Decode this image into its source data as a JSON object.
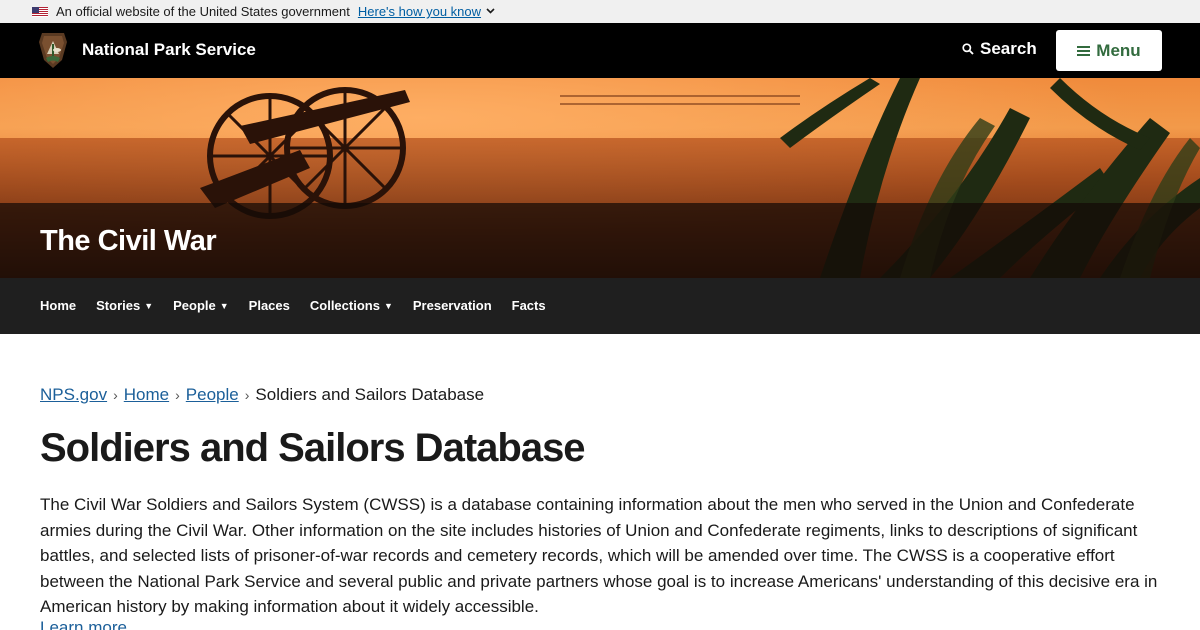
{
  "gov_banner": {
    "text": "An official website of the United States government",
    "link": "Here's how you know"
  },
  "header": {
    "site_title": "National Park Service",
    "search_label": "Search",
    "menu_label": "Menu"
  },
  "hero": {
    "title": "The Civil War"
  },
  "sub_nav": {
    "items": [
      {
        "label": "Home",
        "has_dropdown": false
      },
      {
        "label": "Stories",
        "has_dropdown": true
      },
      {
        "label": "People",
        "has_dropdown": true
      },
      {
        "label": "Places",
        "has_dropdown": false
      },
      {
        "label": "Collections",
        "has_dropdown": true
      },
      {
        "label": "Preservation",
        "has_dropdown": false
      },
      {
        "label": "Facts",
        "has_dropdown": false
      }
    ]
  },
  "breadcrumb": {
    "items": [
      "NPS.gov",
      "Home",
      "People"
    ],
    "current": "Soldiers and Sailors Database"
  },
  "main": {
    "title": "Soldiers and Sailors Database",
    "intro": "The Civil War Soldiers and Sailors System (CWSS) is a database containing information about the men who served in the Union and Confederate armies during the Civil War. Other information on the site includes histories of Union and Confederate regiments, links to descriptions of significant battles, and selected lists of prisoner-of-war records and cemetery records, which will be amended over time. The CWSS is a cooperative effort between the National Park Service and several public and private partners whose goal is to increase Americans' understanding of this decisive era in American history by making information about it widely accessible.",
    "learn_more": "Learn more"
  },
  "colors": {
    "header_bg": "#000000",
    "menu_text": "#326b3e",
    "link": "#1b5f99",
    "subnav_bg": "#1f1f1f"
  }
}
